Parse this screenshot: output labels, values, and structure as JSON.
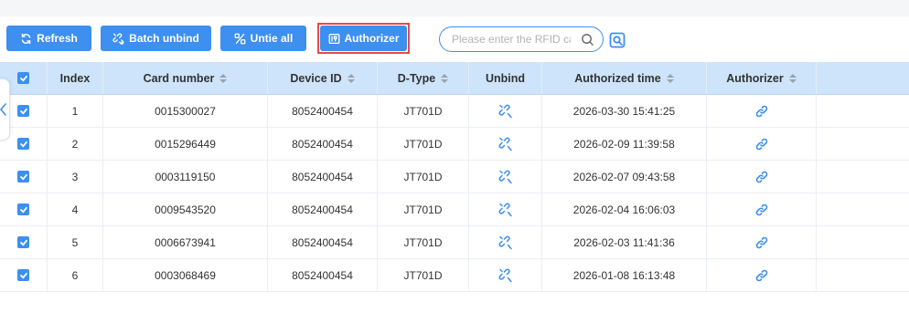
{
  "toolbar": {
    "refresh_label": "Refresh",
    "batch_unbind_label": "Batch unbind",
    "untie_all_label": "Untie all",
    "authorizer_label": "Authorizer"
  },
  "search": {
    "placeholder": "Please enter the RFID card number"
  },
  "table": {
    "headers": {
      "index": "Index",
      "card_number": "Card number",
      "device_id": "Device ID",
      "d_type": "D-Type",
      "unbind": "Unbind",
      "authorized_time": "Authorized time",
      "authorizer": "Authorizer"
    },
    "rows": [
      {
        "index": "1",
        "card_number": "0015300027",
        "device_id": "8052400454",
        "d_type": "JT701D",
        "authorized_time": "2026-03-30 15:41:25"
      },
      {
        "index": "2",
        "card_number": "0015296449",
        "device_id": "8052400454",
        "d_type": "JT701D",
        "authorized_time": "2026-02-09 11:39:58"
      },
      {
        "index": "3",
        "card_number": "0003119150",
        "device_id": "8052400454",
        "d_type": "JT701D",
        "authorized_time": "2026-02-07 09:43:58"
      },
      {
        "index": "4",
        "card_number": "0009543520",
        "device_id": "8052400454",
        "d_type": "JT701D",
        "authorized_time": "2026-02-04 16:06:03"
      },
      {
        "index": "5",
        "card_number": "0006673941",
        "device_id": "8052400454",
        "d_type": "JT701D",
        "authorized_time": "2026-02-03 11:41:36"
      },
      {
        "index": "6",
        "card_number": "0003068469",
        "device_id": "8052400454",
        "d_type": "JT701D",
        "authorized_time": "2026-01-08 16:13:48"
      }
    ]
  },
  "colors": {
    "accent": "#3d8ff0",
    "header_bg": "#cde4fa",
    "highlight": "#e84a4a"
  },
  "icons": {
    "refresh": "refresh-icon",
    "batch_unbind": "unlink-icon",
    "untie_all": "untie-icon",
    "authorizer": "authorizer-icon",
    "search": "search-icon",
    "advanced_search": "advanced-search-icon",
    "row_unbind": "unlink-icon",
    "row_authorizer": "link-icon"
  }
}
